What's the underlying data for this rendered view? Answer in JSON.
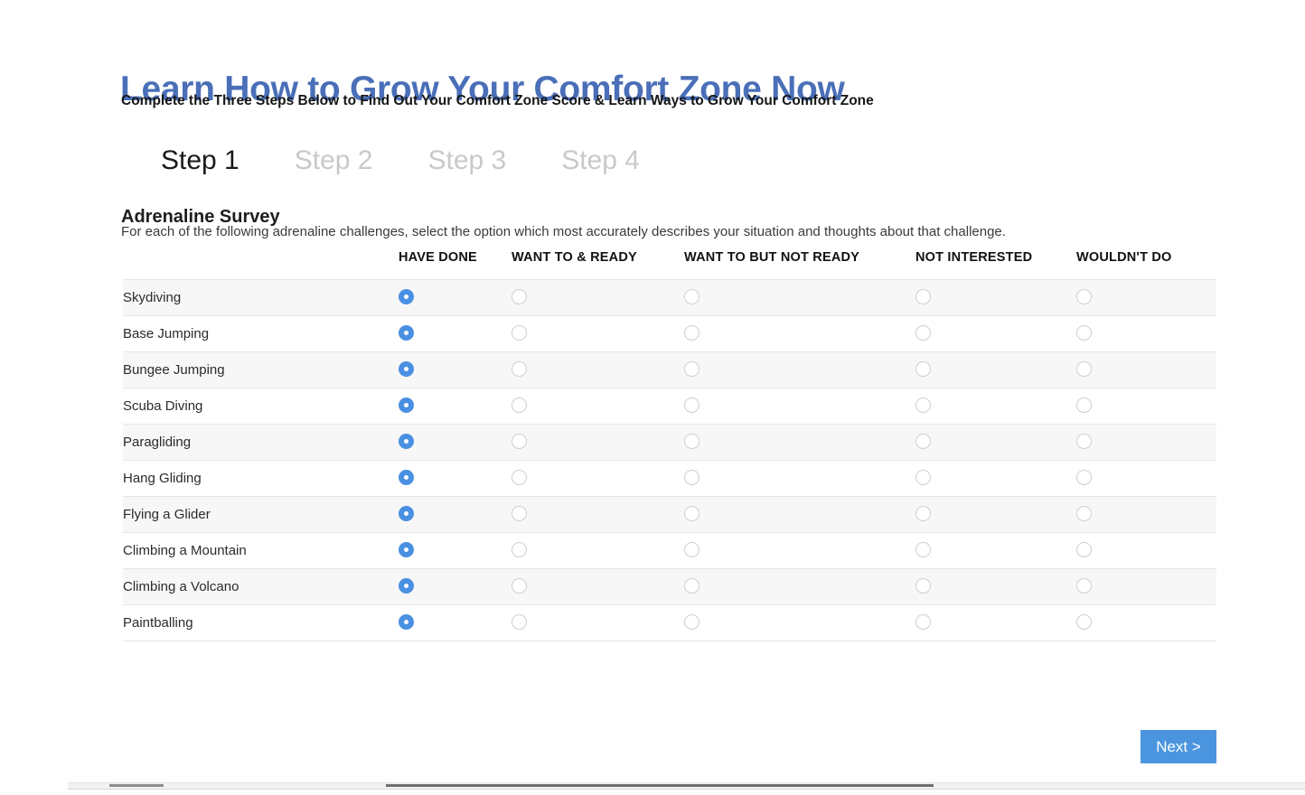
{
  "header": {
    "title": "Learn How to Grow Your Comfort Zone Now",
    "subtitle": "Complete the Three Steps Below to Find Out Your Comfort Zone Score & Learn Ways to Grow Your Comfort Zone",
    "title_color": "#4a6fb8"
  },
  "steps": [
    {
      "label": "Step 1",
      "active": true
    },
    {
      "label": "Step 2",
      "active": false
    },
    {
      "label": "Step 3",
      "active": false
    },
    {
      "label": "Step 4",
      "active": false
    }
  ],
  "section": {
    "title": "Adrenaline Survey",
    "description": "For each of the following adrenaline challenges, select the option which most accurately describes your situation and thoughts about that challenge."
  },
  "survey": {
    "label_column_header": "",
    "columns": [
      "HAVE DONE",
      "WANT TO & READY",
      "WANT TO BUT NOT READY",
      "NOT INTERESTED",
      "WOULDN'T DO"
    ],
    "rows": [
      {
        "label": "Skydiving",
        "selected": 0
      },
      {
        "label": "Base Jumping",
        "selected": 0
      },
      {
        "label": "Bungee Jumping",
        "selected": 0
      },
      {
        "label": "Scuba Diving",
        "selected": 0
      },
      {
        "label": "Paragliding",
        "selected": 0
      },
      {
        "label": "Hang Gliding",
        "selected": 0
      },
      {
        "label": "Flying a Glider",
        "selected": 0
      },
      {
        "label": "Climbing a Mountain",
        "selected": 0
      },
      {
        "label": "Climbing a Volcano",
        "selected": 0
      },
      {
        "label": "Paintballing",
        "selected": 0
      }
    ]
  },
  "footer": {
    "next_label": "Next >",
    "next_color": "#4a95de"
  }
}
